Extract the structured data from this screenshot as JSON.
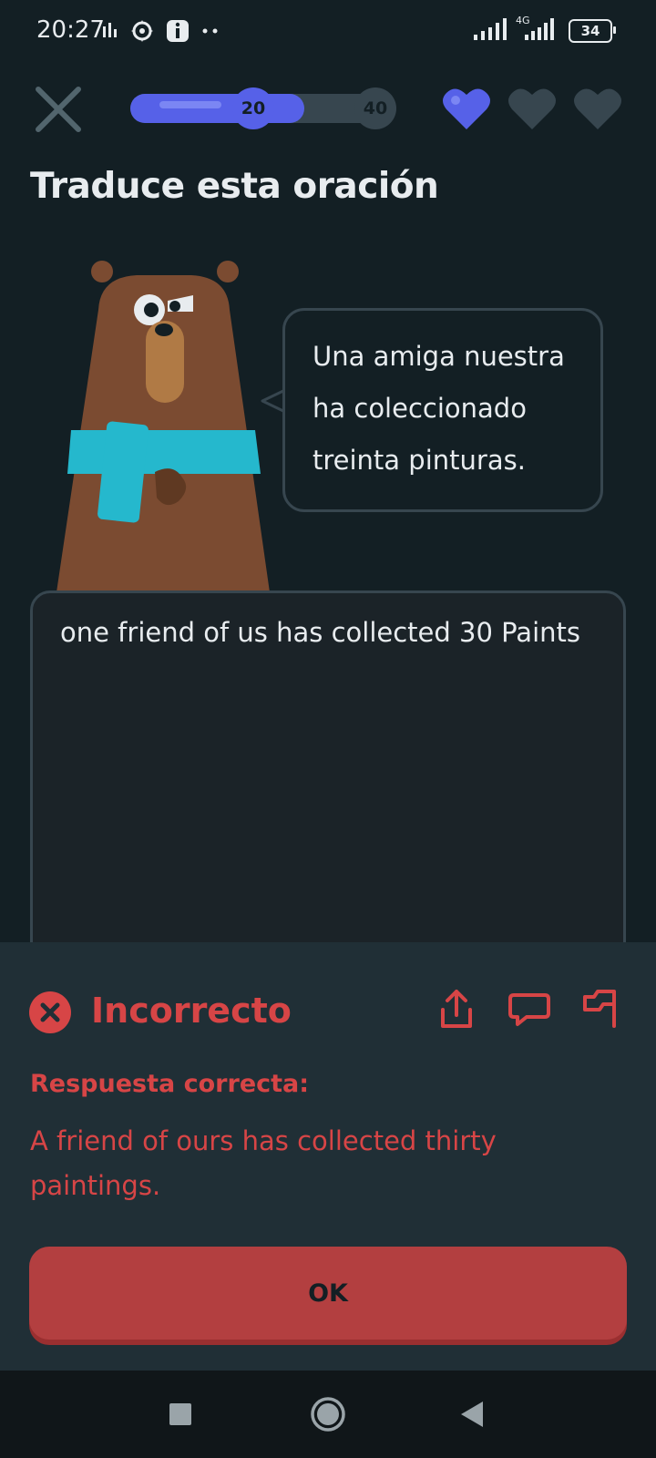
{
  "status_bar": {
    "time": "20:27",
    "left_icons": [
      "activity-icon",
      "vpn-icon",
      "info-icon",
      "more-dots-icon"
    ],
    "network_label": "4G",
    "battery": "34"
  },
  "progress": {
    "current_label": "20",
    "target_label": "40",
    "fraction": 0.66
  },
  "hearts": {
    "total": 3,
    "filled": 1
  },
  "heading": "Traduce esta oración",
  "prompt": {
    "lines": [
      "Una amiga nuestra",
      "ha coleccionado",
      "treinta pinturas."
    ]
  },
  "answer": {
    "text": "one friend of us has collected 30 Paints"
  },
  "feedback": {
    "title": "Incorrecto",
    "correct_label": "Respuesta correcta:",
    "correct_answer": "A friend of ours has collected thirty paintings.",
    "actions": [
      "share-icon",
      "comment-icon",
      "flag-icon"
    ]
  },
  "ok_button": {
    "label": "OK"
  },
  "colors": {
    "background": "#131f24",
    "accent": "#5661e8",
    "error": "#d74546",
    "panel": "#202f36"
  }
}
